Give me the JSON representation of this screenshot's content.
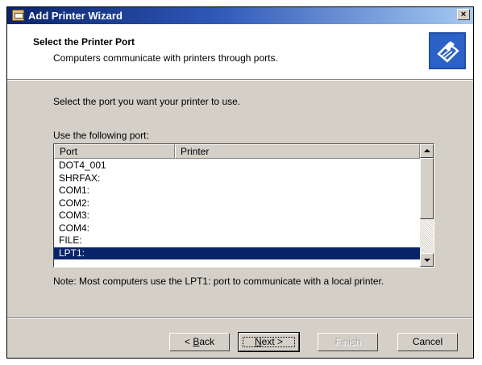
{
  "window": {
    "title": "Add Printer Wizard",
    "close_label": "×"
  },
  "header": {
    "title": "Select the Printer Port",
    "subtitle": "Computers communicate with printers through ports."
  },
  "content": {
    "instruction": "Select the port you want your printer to use.",
    "list_label": "Use the following port:",
    "columns": [
      "Port",
      "Printer"
    ],
    "ports": [
      "DOT4_001",
      "SHRFAX:",
      "COM1:",
      "COM2:",
      "COM3:",
      "COM4:",
      "FILE:",
      "LPT1:"
    ],
    "selected_port": "LPT1:",
    "note": "Note: Most computers use the LPT1: port to communicate with a local printer."
  },
  "buttons": {
    "back_prefix": "< ",
    "back_key": "B",
    "back_rest": "ack",
    "next_key": "N",
    "next_rest": "ext >",
    "finish": "Finish",
    "cancel": "Cancel"
  },
  "colors": {
    "selection": "#0a246a",
    "title_gradient_start": "#0a246a",
    "title_gradient_end": "#a6caf0",
    "dialog_face": "#d4d0c8"
  }
}
